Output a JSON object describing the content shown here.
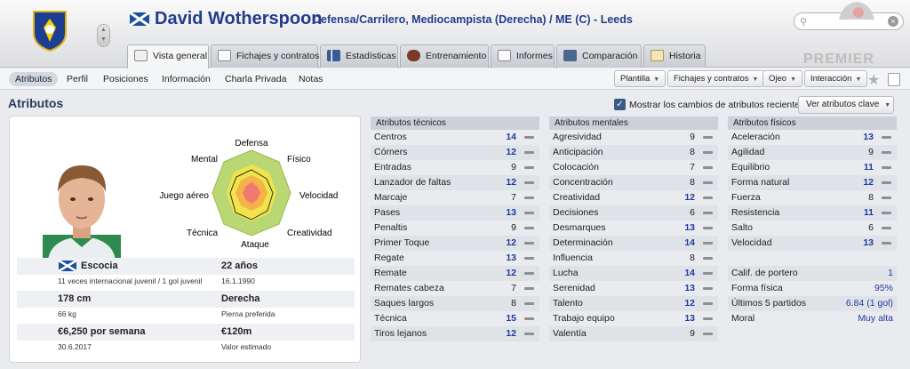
{
  "header": {
    "player_name": "David Wotherspoon",
    "subtitle": "Defensa/Carrilero, Mediocampista (Derecha) / ME (C) - Leeds",
    "search_placeholder": "",
    "brand_logo_text": "PREMIER"
  },
  "tabs": [
    {
      "label": "Vista general",
      "icon": "profile-icon",
      "active": true
    },
    {
      "label": "Fichajes y contratos",
      "icon": "document-icon"
    },
    {
      "label": "Estadísticas",
      "icon": "bar-chart-icon"
    },
    {
      "label": "Entrenamiento",
      "icon": "training-ball-icon"
    },
    {
      "label": "Informes",
      "icon": "report-icon"
    },
    {
      "label": "Comparación",
      "icon": "compare-icon"
    },
    {
      "label": "Historia",
      "icon": "history-icon"
    }
  ],
  "subnav": {
    "items": [
      "Atributos",
      "Perfil",
      "Posiciones",
      "Información",
      "Charla Privada",
      "Notas"
    ],
    "active": "Atributos",
    "dropdowns": [
      "Plantilla",
      "Fichajes y contratos",
      "Ojeo",
      "Interacción"
    ]
  },
  "section": {
    "title": "Atributos",
    "checkbox_label": "Mostrar los cambios de atributos recientes",
    "checkbox_checked": true,
    "key_attr_button": "Ver atributos clave"
  },
  "radar": {
    "labels": [
      "Defensa",
      "Físico",
      "Velocidad",
      "Creatividad",
      "Ataque",
      "Técnica",
      "Juego aéreo",
      "Mental"
    ]
  },
  "bio": {
    "nation": "Escocia",
    "age": "22 años",
    "caps": "11 veces internacional juvenil / 1 gol juvenil",
    "dob": "16.1.1990",
    "height": "178 cm",
    "foot": "Derecha",
    "weight": "66 kg",
    "foot_label": "Pierna preferida",
    "wage": "€6,250 por semana",
    "value": "€120m",
    "contract": "30.6.2017",
    "value_label": "Valor estimado"
  },
  "technical": {
    "title": "Atributos técnicos",
    "rows": [
      {
        "label": "Centros",
        "value": "14"
      },
      {
        "label": "Córners",
        "value": "12"
      },
      {
        "label": "Entradas",
        "value": "9"
      },
      {
        "label": "Lanzador de faltas",
        "value": "12"
      },
      {
        "label": "Marcaje",
        "value": "7"
      },
      {
        "label": "Pases",
        "value": "13"
      },
      {
        "label": "Penaltis",
        "value": "9"
      },
      {
        "label": "Primer Toque",
        "value": "12"
      },
      {
        "label": "Regate",
        "value": "13"
      },
      {
        "label": "Remate",
        "value": "12"
      },
      {
        "label": "Remates cabeza",
        "value": "7"
      },
      {
        "label": "Saques largos",
        "value": "8"
      },
      {
        "label": "Técnica",
        "value": "15"
      },
      {
        "label": "Tiros lejanos",
        "value": "12"
      }
    ]
  },
  "mental": {
    "title": "Atributos mentales",
    "rows": [
      {
        "label": "Agresividad",
        "value": "9"
      },
      {
        "label": "Anticipación",
        "value": "8"
      },
      {
        "label": "Colocación",
        "value": "7"
      },
      {
        "label": "Concentración",
        "value": "8"
      },
      {
        "label": "Creatividad",
        "value": "12"
      },
      {
        "label": "Decisiones",
        "value": "6"
      },
      {
        "label": "Desmarques",
        "value": "13"
      },
      {
        "label": "Determinación",
        "value": "14"
      },
      {
        "label": "Influencia",
        "value": "8"
      },
      {
        "label": "Lucha",
        "value": "14"
      },
      {
        "label": "Serenidad",
        "value": "13"
      },
      {
        "label": "Talento",
        "value": "12"
      },
      {
        "label": "Trabajo equipo",
        "value": "13"
      },
      {
        "label": "Valentía",
        "value": "9"
      }
    ]
  },
  "physical": {
    "title": "Atributos físicos",
    "rows": [
      {
        "label": "Aceleración",
        "value": "13"
      },
      {
        "label": "Agilidad",
        "value": "9"
      },
      {
        "label": "Equilibrio",
        "value": "11"
      },
      {
        "label": "Forma natural",
        "value": "12"
      },
      {
        "label": "Fuerza",
        "value": "8"
      },
      {
        "label": "Resistencia",
        "value": "11"
      },
      {
        "label": "Salto",
        "value": "6"
      },
      {
        "label": "Velocidad",
        "value": "13"
      }
    ],
    "extra": [
      {
        "label": "Calif. de portero",
        "value": "1"
      },
      {
        "label": "Forma física",
        "value": "95%"
      },
      {
        "label": "Últimos 5 partidos",
        "value": "6.84 (1 gol)"
      },
      {
        "label": "Moral",
        "value": "Muy alta"
      }
    ]
  },
  "colors": {
    "accent": "#233c8c",
    "highlight_value": "#2038a6"
  }
}
